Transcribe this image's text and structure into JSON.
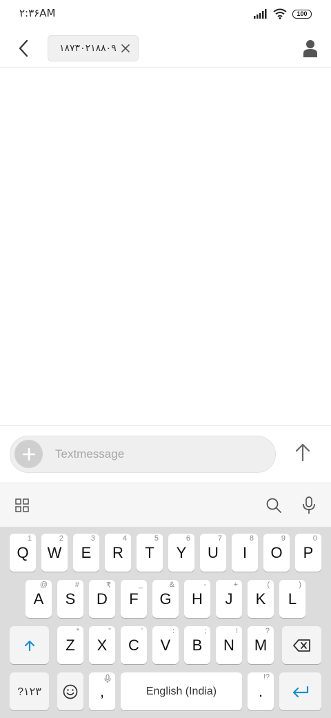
{
  "status": {
    "time": "۲:۳۶AM",
    "battery": "100"
  },
  "header": {
    "recipient": "۱۸۷۳۰۲۱۸۸۰۹"
  },
  "compose": {
    "placeholder": "Textmessage",
    "value": ""
  },
  "keyboard": {
    "row1": [
      {
        "label": "Q",
        "hint": "1"
      },
      {
        "label": "W",
        "hint": "2"
      },
      {
        "label": "E",
        "hint": "3"
      },
      {
        "label": "R",
        "hint": "4"
      },
      {
        "label": "T",
        "hint": "5"
      },
      {
        "label": "Y",
        "hint": "6"
      },
      {
        "label": "U",
        "hint": "7"
      },
      {
        "label": "I",
        "hint": "8"
      },
      {
        "label": "O",
        "hint": "9"
      },
      {
        "label": "P",
        "hint": "0"
      }
    ],
    "row2": [
      {
        "label": "A",
        "hint": "@"
      },
      {
        "label": "S",
        "hint": "#"
      },
      {
        "label": "D",
        "hint": "₹"
      },
      {
        "label": "F",
        "hint": "_"
      },
      {
        "label": "G",
        "hint": "&"
      },
      {
        "label": "H",
        "hint": "-"
      },
      {
        "label": "J",
        "hint": "+"
      },
      {
        "label": "K",
        "hint": "("
      },
      {
        "label": "L",
        "hint": ")"
      }
    ],
    "row3": [
      {
        "label": "Z",
        "hint": "*"
      },
      {
        "label": "X",
        "hint": "\""
      },
      {
        "label": "C",
        "hint": "'"
      },
      {
        "label": "V",
        "hint": ":"
      },
      {
        "label": "B",
        "hint": ";"
      },
      {
        "label": "N",
        "hint": "!"
      },
      {
        "label": "M",
        "hint": "?"
      }
    ],
    "symbols_label": "?۱۲۳",
    "comma_label": ",",
    "space_label": "English (India)",
    "period_label": ".",
    "period_hint": "!?"
  }
}
